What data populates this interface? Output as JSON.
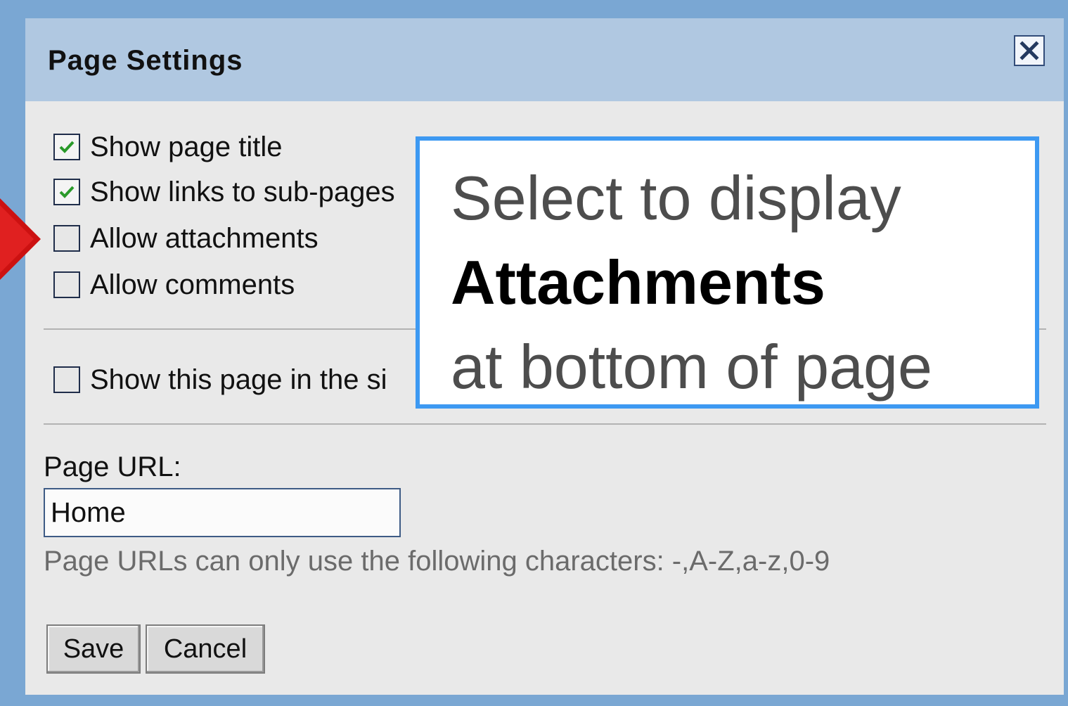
{
  "dialog": {
    "title": "Page Settings",
    "close_icon": "close-icon"
  },
  "options": [
    {
      "label": "Show page title",
      "checked": true
    },
    {
      "label": "Show links to sub-pages",
      "checked": true
    },
    {
      "label": "Allow attachments",
      "checked": false
    },
    {
      "label": "Allow comments",
      "checked": false
    }
  ],
  "sidebar_option": {
    "label": "Show this page in the si",
    "checked": false
  },
  "url": {
    "label": "Page URL:",
    "value": "Home",
    "hint": "Page URLs can only use the following characters: -,A-Z,a-z,0-9"
  },
  "buttons": {
    "save": "Save",
    "cancel": "Cancel"
  },
  "callout": {
    "line1": "Select to display",
    "line2": "Attachments",
    "line3": "at bottom of page"
  },
  "colors": {
    "titlebar": "#b0c8e1",
    "frame": "#7aa7d3",
    "callout_border": "#3d99f2",
    "arrow": "#cc1111",
    "check": "#2a9a2a"
  }
}
